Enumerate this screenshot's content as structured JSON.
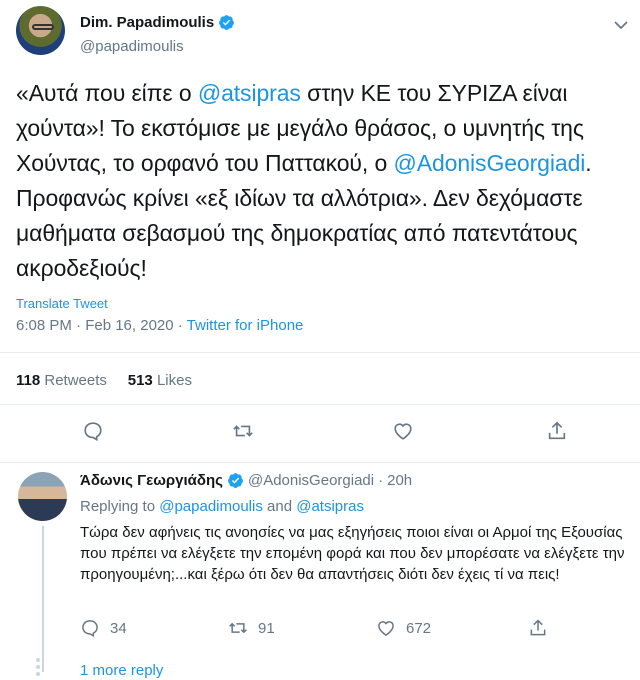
{
  "main_tweet": {
    "name": "Dim. Papadimoulis",
    "handle": "@papadimoulis",
    "text": {
      "p1": "«Αυτά που είπε ο ",
      "m1": "@atsipras",
      "p2": " στην ΚΕ του ΣΥΡΙΖΑ είναι χούντα»! Το εκστόμισε με μεγάλο θράσος, ο υμνητής της Χούντας, το ορφανό του Παττακού, ο ",
      "m2": "@AdonisGeorgiadi",
      "p3": ". Προφανώς κρίνει «εξ ιδίων τα αλλότρια». Δεν δεχόμαστε μαθήματα σεβασμού της δημοκρατίας από πατεντάτους ακροδεξιούς!"
    },
    "translate_label": "Translate Tweet",
    "time": "6:08 PM · Feb 16, 2020 · ",
    "source": "Twitter for iPhone",
    "retweets": "118",
    "retweets_label": "Retweets",
    "likes": "513",
    "likes_label": "Likes"
  },
  "reply": {
    "name": "Άδωνις Γεωργιάδης",
    "handle": "@AdonisGeorgiadi",
    "dot": "·",
    "age": "20h",
    "replying_prefix": "Replying to ",
    "replying_to_1": "@papadimoulis",
    "replying_and": " and ",
    "replying_to_2": "@atsipras",
    "text": "Τώρα δεν αφήνεις τις ανοησίες να μας εξηγήσεις ποιοι είναι οι Αρμοί της Εξουσίας που πρέπει να ελέγξετε την επομένη φορά και που δεν μπορέσατε να ελέγξετε την προηγουμένη;...και ξέρω ότι δεν θα απαντήσεις διότι δεν έχεις τί να πεις!",
    "reply_count": "34",
    "retweet_count": "91",
    "like_count": "672",
    "more_replies": "1 more reply"
  },
  "colors": {
    "link": "#1b95e0",
    "muted": "#657786",
    "text": "#14171a",
    "divider": "#e6ecf0"
  },
  "icons": [
    "verified-badge-icon",
    "chevron-down-icon",
    "reply-icon",
    "retweet-icon",
    "like-icon",
    "share-icon"
  ]
}
